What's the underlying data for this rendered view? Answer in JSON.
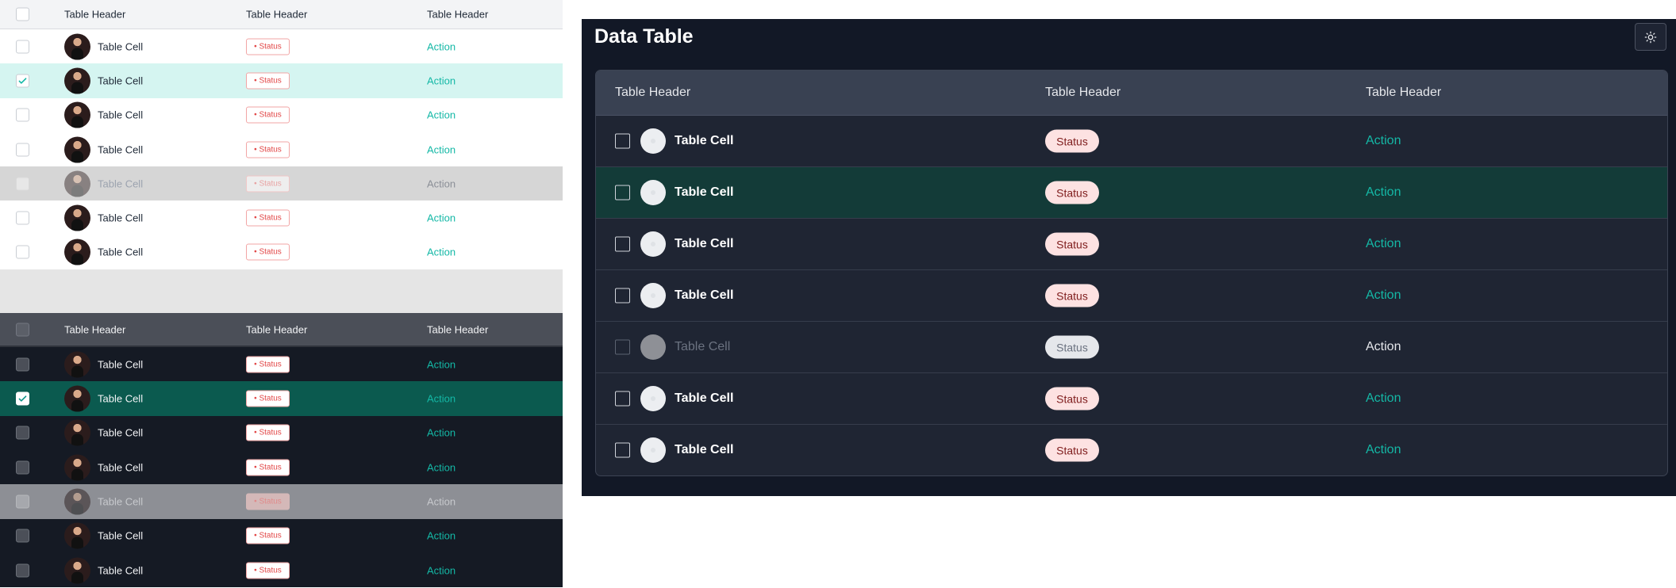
{
  "left_light": {
    "headers": [
      "Table Header",
      "Table Header",
      "Table Header"
    ],
    "rows": [
      {
        "cell": "Table Cell",
        "status": "• Status",
        "action": "Action",
        "state": "normal"
      },
      {
        "cell": "Table Cell",
        "status": "• Status",
        "action": "Action",
        "state": "selected"
      },
      {
        "cell": "Table Cell",
        "status": "• Status",
        "action": "Action",
        "state": "normal"
      },
      {
        "cell": "Table Cell",
        "status": "• Status",
        "action": "Action",
        "state": "normal"
      },
      {
        "cell": "Table Cell",
        "status": "• Status",
        "action": "Action",
        "state": "disabled"
      },
      {
        "cell": "Table Cell",
        "status": "• Status",
        "action": "Action",
        "state": "normal"
      },
      {
        "cell": "Table Cell",
        "status": "• Status",
        "action": "Action",
        "state": "normal"
      }
    ]
  },
  "left_dark": {
    "headers": [
      "Table Header",
      "Table Header",
      "Table Header"
    ],
    "rows": [
      {
        "cell": "Table Cell",
        "status": "• Status",
        "action": "Action",
        "state": "normal"
      },
      {
        "cell": "Table Cell",
        "status": "• Status",
        "action": "Action",
        "state": "selected"
      },
      {
        "cell": "Table Cell",
        "status": "• Status",
        "action": "Action",
        "state": "normal"
      },
      {
        "cell": "Table Cell",
        "status": "• Status",
        "action": "Action",
        "state": "normal"
      },
      {
        "cell": "Table Cell",
        "status": "• Status",
        "action": "Action",
        "state": "disabled"
      },
      {
        "cell": "Table Cell",
        "status": "• Status",
        "action": "Action",
        "state": "normal"
      },
      {
        "cell": "Table Cell",
        "status": "• Status",
        "action": "Action",
        "state": "normal"
      }
    ]
  },
  "panel": {
    "title": "Data Table",
    "theme_icon": "sun-icon",
    "headers": [
      "Table Header",
      "Table Header",
      "Table Header"
    ],
    "rows": [
      {
        "cell": "Table Cell",
        "status": "Status",
        "action": "Action",
        "state": "normal"
      },
      {
        "cell": "Table Cell",
        "status": "Status",
        "action": "Action",
        "state": "selected"
      },
      {
        "cell": "Table Cell",
        "status": "Status",
        "action": "Action",
        "state": "normal"
      },
      {
        "cell": "Table Cell",
        "status": "Status",
        "action": "Action",
        "state": "normal"
      },
      {
        "cell": "Table Cell",
        "status": "Status",
        "action": "Action",
        "state": "disabled"
      },
      {
        "cell": "Table Cell",
        "status": "Status",
        "action": "Action",
        "state": "normal"
      },
      {
        "cell": "Table Cell",
        "status": "Status",
        "action": "Action",
        "state": "normal"
      }
    ]
  },
  "colors": {
    "accent": "#14b8a6",
    "status_red": "#e24848",
    "panel_bg": "#121826"
  }
}
